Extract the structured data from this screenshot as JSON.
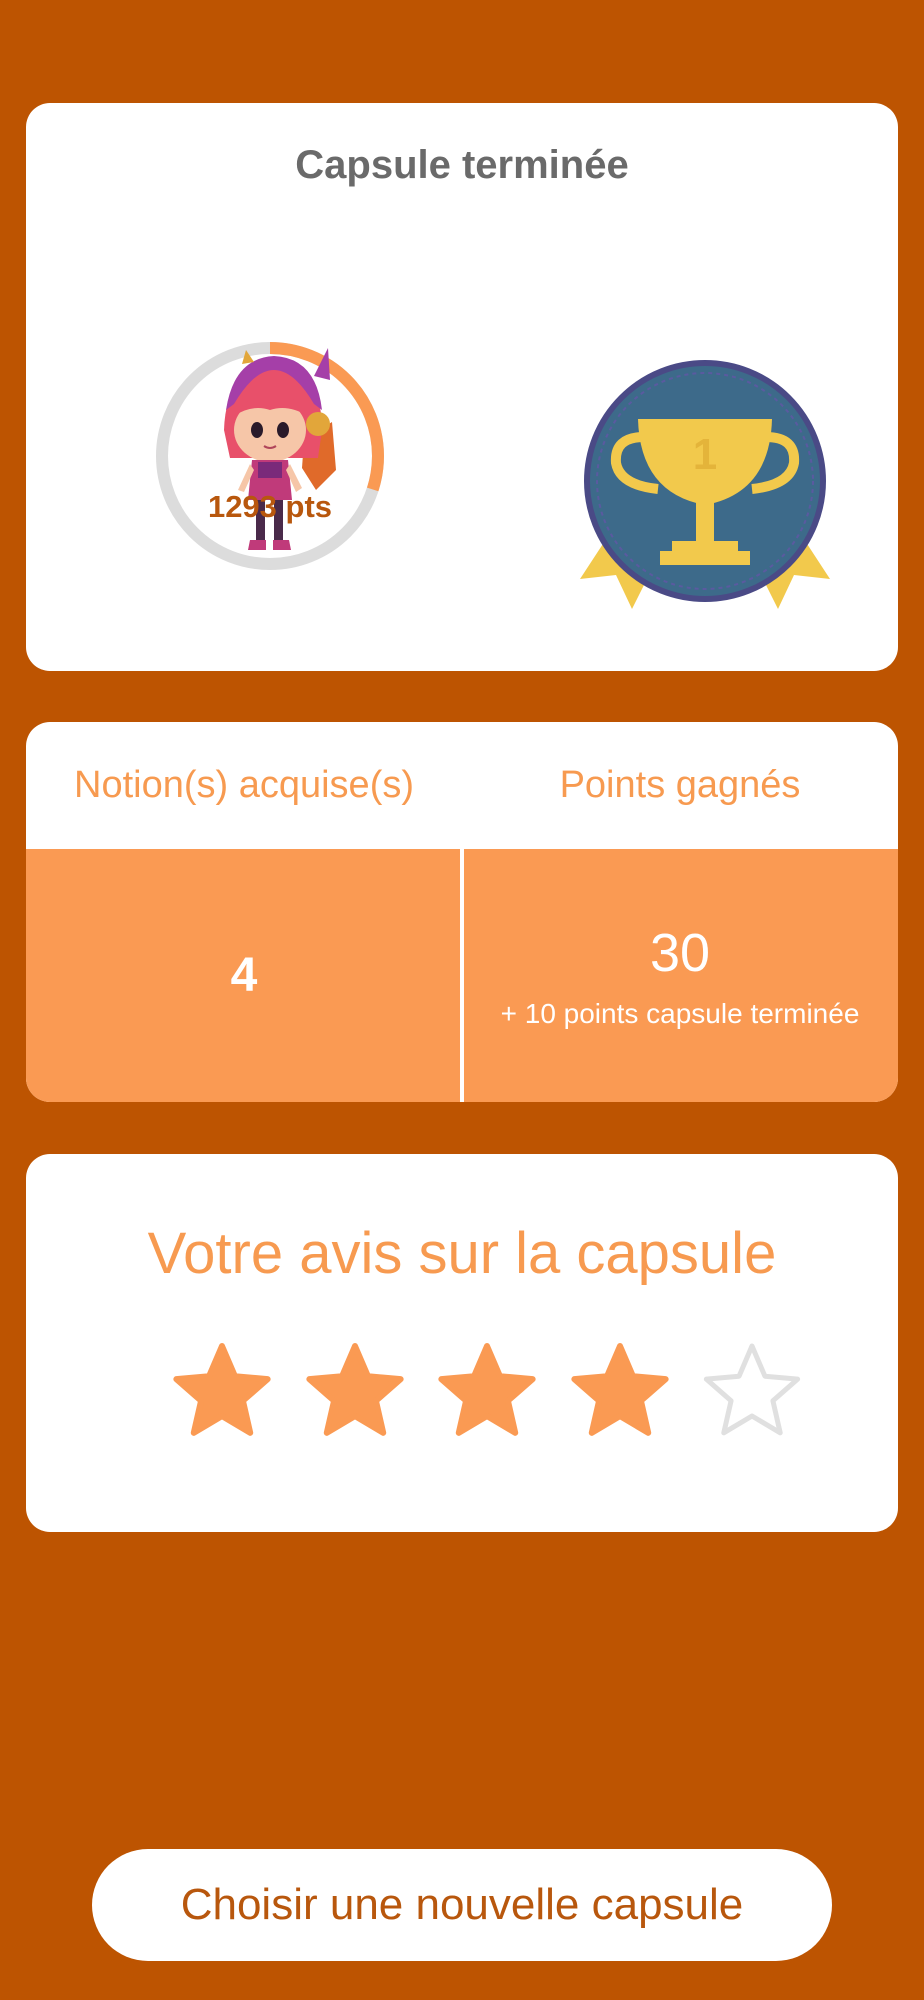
{
  "summary": {
    "title": "Capsule terminée",
    "points": "1293 pts",
    "progress_ring_fraction": 0.3,
    "trophy_rank": "1"
  },
  "stats": {
    "notions_header": "Notion(s) acquise(s)",
    "points_header": "Points gagnés",
    "notions_value": "4",
    "points_value": "30",
    "points_bonus": "+ 10 points capsule terminée"
  },
  "rating": {
    "title": "Votre avis sur la capsule",
    "value": 4,
    "max": 5,
    "icons": [
      "star-filled-icon",
      "star-filled-icon",
      "star-filled-icon",
      "star-filled-icon",
      "star-empty-icon"
    ]
  },
  "cta": {
    "label": "Choisir une nouvelle capsule"
  },
  "colors": {
    "background": "#bd5401",
    "accent": "#fa9a53",
    "dark_accent": "#b8570d",
    "trophy_badge": "#3d6a8a",
    "trophy_gold": "#f2c94c"
  }
}
